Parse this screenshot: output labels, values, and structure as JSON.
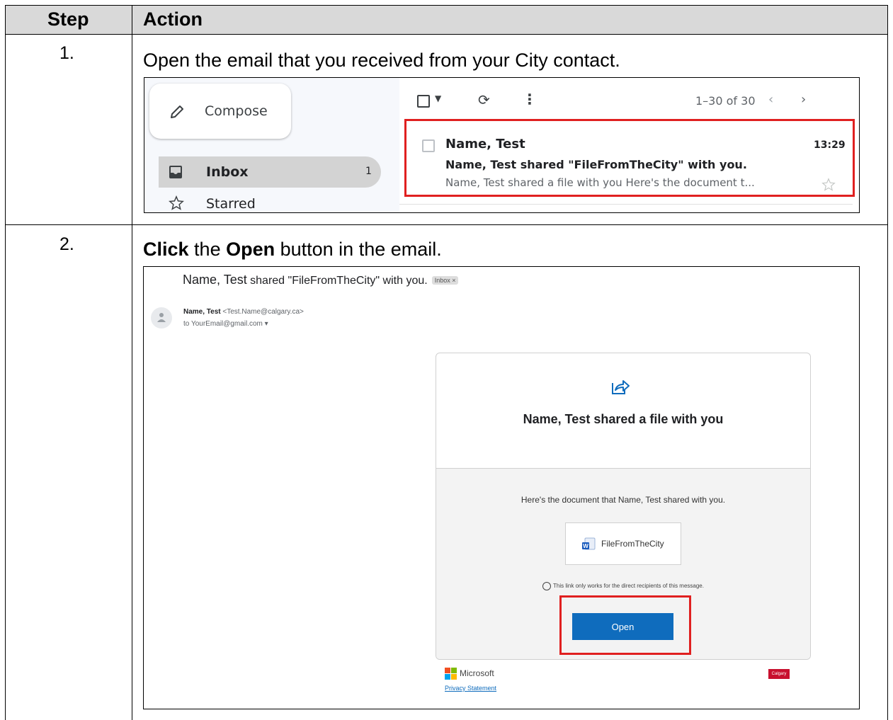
{
  "table": {
    "header": {
      "step": "Step",
      "action": "Action"
    },
    "rows": [
      {
        "number": "1.",
        "instruction": "Open the email that you received from your City contact."
      },
      {
        "number": "2.",
        "instruction_parts": [
          "Click",
          " the ",
          "Open",
          " button in the email."
        ]
      }
    ]
  },
  "inbox_screenshot": {
    "compose_label": "Compose",
    "nav": [
      {
        "label": "Inbox",
        "count": "1"
      },
      {
        "label": "Starred"
      }
    ],
    "pagination": "1–30 of 30",
    "email": {
      "sender": "Name, Test",
      "time": "13:29",
      "subject": "Name, Test shared \"FileFromTheCity\" with you.",
      "snippet": "Name, Test shared a file with you Here's the document t..."
    },
    "highlight_color": "#e02020"
  },
  "email_screenshot": {
    "subject_name": "Name, Test",
    "subject_rest": " shared \"FileFromTheCity\" with you.",
    "label_chip": "Inbox ×",
    "sender_name": "Name, Test",
    "sender_email": "<Test.Name@calgary.ca>",
    "recipient": "to YourEmail@gmail.com ▾",
    "card": {
      "title": "Name, Test shared a file with you",
      "description": "Here's the document that Name, Test shared with you.",
      "file_name": "FileFromTheCity",
      "link_note": "This link only works for the direct recipients of this message.",
      "open_button": "Open"
    },
    "footer": {
      "microsoft": "Microsoft",
      "privacy": "Privacy Statement",
      "calgary_logo": "Calgary"
    },
    "accent_color": "#0f6cbd",
    "highlight_color": "#e02020"
  }
}
